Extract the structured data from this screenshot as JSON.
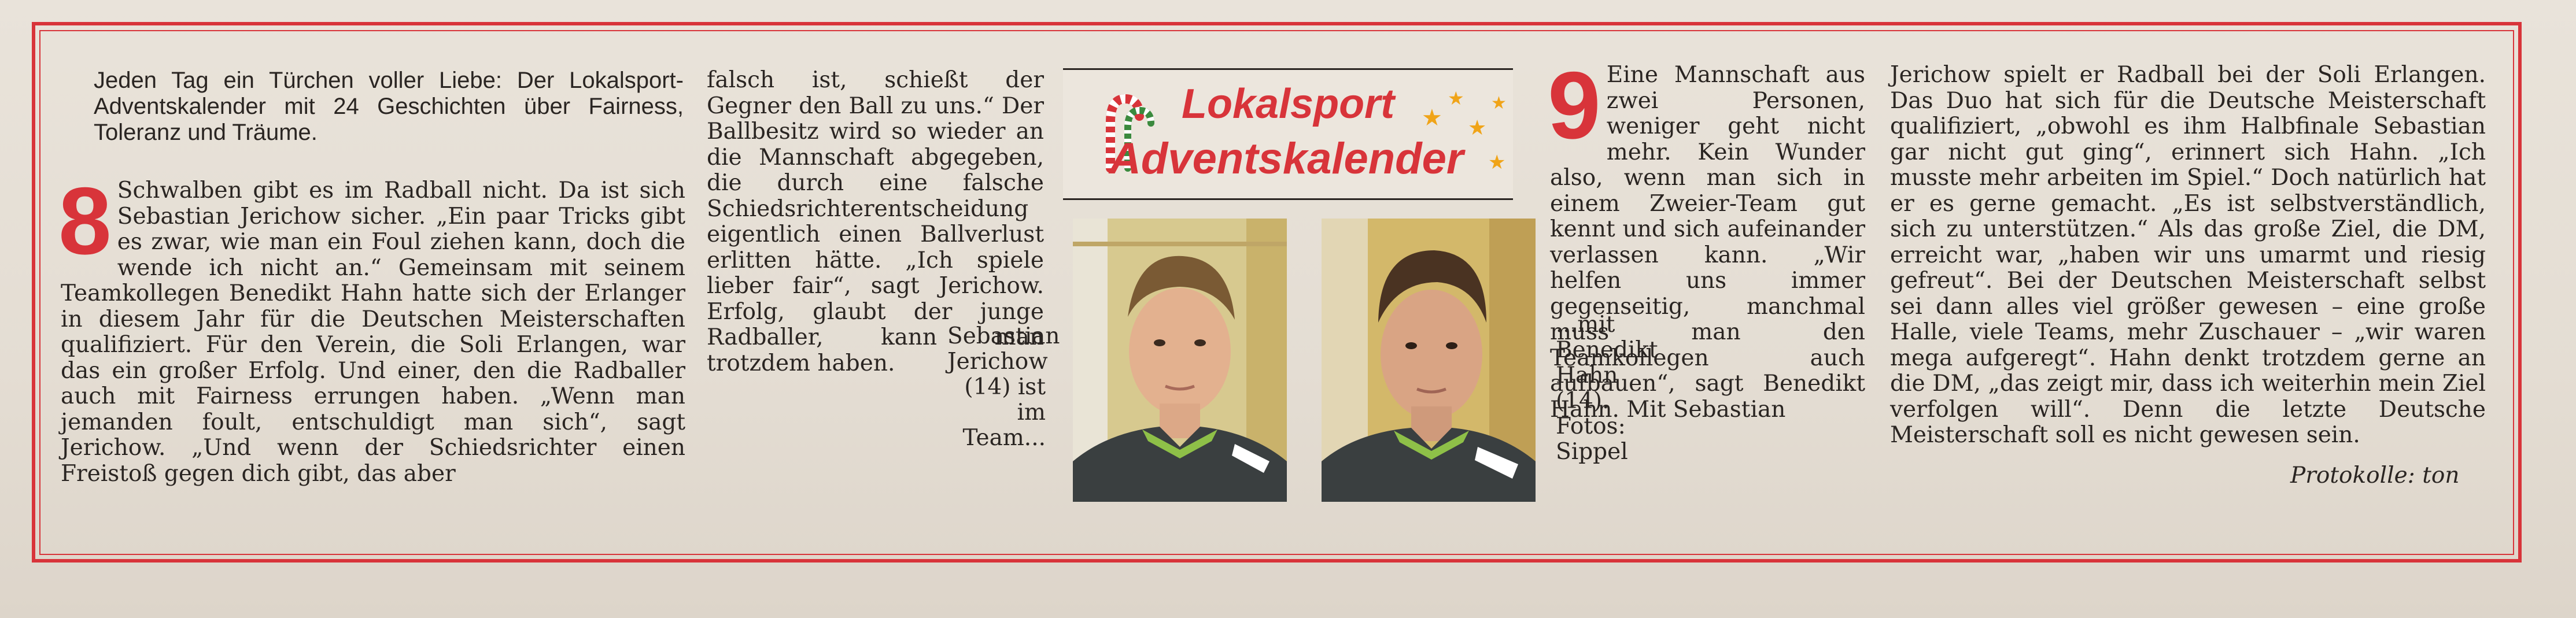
{
  "intro": "Jeden Tag ein Türchen voller Liebe: Der Lokalsport-Adventskalender mit 24 Geschichten über Fairness, Toleranz und Träume.",
  "banner": {
    "line1": "Lokalsport",
    "line2": "Adventskalender"
  },
  "story8": {
    "number": "8",
    "col1": "Schwalben gibt es im Radball nicht. Da ist sich Sebastian Jerichow sicher. „Ein paar Tricks gibt es zwar, wie man ein Foul ziehen kann, doch die wende ich nicht an.“ Gemeinsam mit seinem Teamkollegen Benedikt Hahn hatte sich der Erlanger in diesem Jahr für die Deutschen Meisterschaften qualifiziert. Für den Verein, die Soli Erlangen, war das ein großer Erfolg. Und einer, den die Radballer auch mit Fairness errungen haben. „Wenn man jemanden foult, entschuldigt man sich“, sagt Jerichow. „Und wenn der Schiedsrichter einen Freistoß gegen dich gibt, das aber",
    "col2": "falsch ist, schießt der Gegner den Ball zu uns.“ Der Ballbesitz wird so wieder an die Mannschaft abgegeben, die durch eine falsche Schiedsrichterentscheidung eigentlich einen Ballverlust erlitten hätte. „Ich spiele lieber fair“, sagt Jerichow. Erfolg, glaubt der junge Radballer, kann man trotzdem haben."
  },
  "caption_left": "Sebastian Jerichow (14) ist im Team...",
  "caption_right": "...mit Benedikt Hahn (14). Fotos: Sippel",
  "story9": {
    "number": "9",
    "col1": "Eine Mannschaft aus zwei Personen, weniger geht nicht mehr. Kein Wunder also, wenn man sich in einem Zweier-Team gut kennt und sich aufeinander verlassen kann. „Wir helfen uns immer gegenseitig, manchmal muss man den Teamkollegen auch aufbauen“, sagt Benedikt Hahn. Mit Sebastian",
    "col2": "Jerichow spielt er Radball bei der Soli Erlangen. Das Duo hat sich für die Deutsche Meisterschaft qualifiziert, „obwohl es ihm Halbfinale Sebastian gar nicht gut ging“, erinnert sich Hahn. „Ich musste mehr arbeiten im Spiel.“ Doch natürlich hat er es gerne gemacht. „Es ist selbstverständlich, sich zu unterstützen.“ Als das große Ziel, die DM, erreicht war, „haben wir uns umarmt und riesig gefreut“. Bei der Deutschen Meisterschaft selbst sei dann alles viel größer gewesen – eine große Halle, viele Teams, mehr Zuschauer – „wir waren mega aufgeregt“. Hahn denkt trotzdem gerne an die DM, „das zeigt mir, dass ich weiterhin mein Ziel verfolgen will“. Denn die letzte Deutsche Meisterschaft soll es nicht gewesen sein."
  },
  "signature": "Protokolle: ton"
}
